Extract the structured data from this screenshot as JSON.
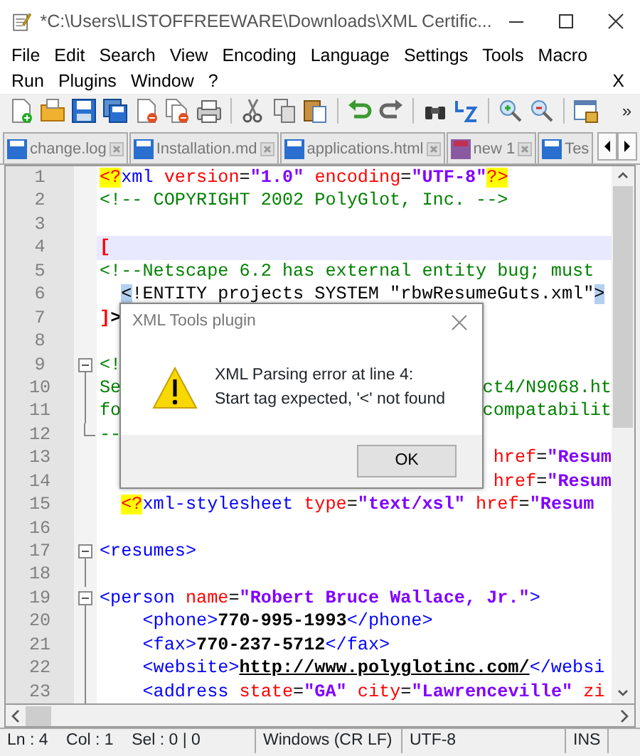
{
  "window": {
    "title": "*C:\\Users\\LISTOFFREEWARE\\Downloads\\XML Certific..."
  },
  "menu": {
    "top_row": [
      "File",
      "Edit",
      "Search",
      "View",
      "Encoding",
      "Language",
      "Settings",
      "Tools",
      "Macro"
    ],
    "bottom_row": [
      "Run",
      "Plugins",
      "Window",
      "?"
    ],
    "close_document": "X"
  },
  "toolbar": {
    "overflow": "»"
  },
  "tabs": [
    {
      "label": "change.log",
      "selected": false,
      "unsaved": false
    },
    {
      "label": "Installation.md",
      "selected": false,
      "unsaved": false
    },
    {
      "label": "applications.html",
      "selected": false,
      "unsaved": false
    },
    {
      "label": "new 1",
      "selected": false,
      "unsaved": true
    },
    {
      "label": "Tes",
      "selected": false,
      "unsaved": false
    }
  ],
  "editor": {
    "lines": [
      {
        "number": "1",
        "tokens": [
          {
            "kind": "pi",
            "text": "<?"
          },
          {
            "kind": "tag",
            "text": "xml"
          },
          {
            "kind": "attr",
            "text": " version"
          },
          {
            "kind": "plain",
            "text": "="
          },
          {
            "kind": "value",
            "text": "\"1.0\""
          },
          {
            "kind": "attr",
            "text": " encoding"
          },
          {
            "kind": "plain",
            "text": "="
          },
          {
            "kind": "value",
            "text": "\"UTF-8\""
          },
          {
            "kind": "pi",
            "text": "?>"
          }
        ]
      },
      {
        "number": "2",
        "tokens": [
          {
            "kind": "comment",
            "text": "<!-- COPYRIGHT 2002 PolyGlot, Inc. -->"
          }
        ]
      },
      {
        "number": "3"
      },
      {
        "number": "4",
        "current": true,
        "tokens": [
          {
            "kind": "bracket",
            "text": "["
          }
        ]
      },
      {
        "number": "5",
        "tokens": [
          {
            "kind": "comment",
            "text": "<!--Netscape 6.2 has external entity bug; must"
          }
        ]
      },
      {
        "number": "6",
        "indented": true,
        "tokens": [
          {
            "kind": "match",
            "text": "<"
          },
          {
            "kind": "dtd",
            "text": "!ENTITY projects SYSTEM \"rbwResumeGuts.xml\""
          },
          {
            "kind": "match",
            "text": ">"
          }
        ]
      },
      {
        "number": "7",
        "tokens": [
          {
            "kind": "bracket",
            "text": "]"
          },
          {
            "kind": "text",
            "text": ">"
          }
        ]
      },
      {
        "number": "8"
      },
      {
        "number": "9",
        "fold_toggle": true,
        "tokens": [
          {
            "kind": "comment",
            "text": "<!"
          }
        ]
      },
      {
        "number": "10",
        "fold_line": true,
        "tokens": [
          {
            "kind": "comment",
            "text": "Se"
          }
        ],
        "right": [
          {
            "kind": "comment",
            "text": "ct4/N9068.ht"
          }
        ]
      },
      {
        "number": "11",
        "fold_line": true,
        "tokens": [
          {
            "kind": "comment",
            "text": "fo"
          }
        ],
        "right": [
          {
            "kind": "comment",
            "text": "compatabilit"
          }
        ]
      },
      {
        "number": "12",
        "fold_end": true,
        "tokens": [
          {
            "kind": "comment",
            "text": "--"
          }
        ]
      },
      {
        "number": "13",
        "right": [
          {
            "kind": "attr",
            "text": "href"
          },
          {
            "kind": "plain",
            "text": "="
          },
          {
            "kind": "value",
            "text": "\"Resum"
          }
        ]
      },
      {
        "number": "14",
        "right": [
          {
            "kind": "attr",
            "text": "href"
          },
          {
            "kind": "plain",
            "text": "="
          },
          {
            "kind": "value",
            "text": "\"Resum"
          }
        ]
      },
      {
        "number": "15",
        "indented": true,
        "tokens": [
          {
            "kind": "pi",
            "text": "<?"
          },
          {
            "kind": "tag",
            "text": "xml-stylesheet"
          },
          {
            "kind": "attr",
            "text": " type"
          },
          {
            "kind": "plain",
            "text": "="
          },
          {
            "kind": "value",
            "text": "\"text/xsl\""
          },
          {
            "kind": "attr",
            "text": " href"
          },
          {
            "kind": "plain",
            "text": "="
          },
          {
            "kind": "value",
            "text": "\"Resum"
          }
        ]
      },
      {
        "number": "16"
      },
      {
        "number": "17",
        "fold_toggle": true,
        "tokens": [
          {
            "kind": "tag",
            "text": "<resumes>"
          }
        ]
      },
      {
        "number": "18",
        "fold_line": true
      },
      {
        "number": "19",
        "fold_toggle": true,
        "tokens": [
          {
            "kind": "tag",
            "text": "<person"
          },
          {
            "kind": "attr",
            "text": " name"
          },
          {
            "kind": "plain",
            "text": "="
          },
          {
            "kind": "value",
            "text": "\"Robert Bruce Wallace, Jr.\""
          },
          {
            "kind": "tag",
            "text": ">"
          }
        ],
        "children": [
          {
            "number": "20",
            "fold_line": true,
            "tokens": [
              {
                "kind": "tag",
                "text": "<phone>"
              },
              {
                "kind": "text",
                "text": "770-995-1993"
              },
              {
                "kind": "tag",
                "text": "</phone>"
              }
            ]
          },
          {
            "number": "21",
            "fold_line": true,
            "tokens": [
              {
                "kind": "tag",
                "text": "<fax>"
              },
              {
                "kind": "text",
                "text": "770-237-5712"
              },
              {
                "kind": "tag",
                "text": "</fax>"
              }
            ]
          },
          {
            "number": "22",
            "fold_line": true,
            "tokens": [
              {
                "kind": "tag",
                "text": "<website>"
              },
              {
                "kind": "link",
                "text": "http://www.polyglotinc.com/"
              },
              {
                "kind": "tag",
                "text": "</websi"
              }
            ]
          },
          {
            "number": "23",
            "fold_line": true,
            "tokens": [
              {
                "kind": "tag",
                "text": "<address"
              },
              {
                "kind": "attr",
                "text": " state"
              },
              {
                "kind": "plain",
                "text": "="
              },
              {
                "kind": "value",
                "text": "\"GA\""
              },
              {
                "kind": "attr",
                "text": " city"
              },
              {
                "kind": "plain",
                "text": "="
              },
              {
                "kind": "value",
                "text": "\"Lawrenceville\""
              },
              {
                "kind": "attr",
                "text": " zi"
              }
            ]
          }
        ]
      }
    ]
  },
  "dialog": {
    "title": "XML Tools plugin",
    "message": [
      "XML Parsing error at line 4:",
      "Start tag expected, '<' not found"
    ],
    "button": "OK"
  },
  "status_bar": [
    "Ln : 4    Col : 1    Sel : 0 | 0",
    "Windows (CR LF)",
    "UTF-8",
    "INS"
  ]
}
